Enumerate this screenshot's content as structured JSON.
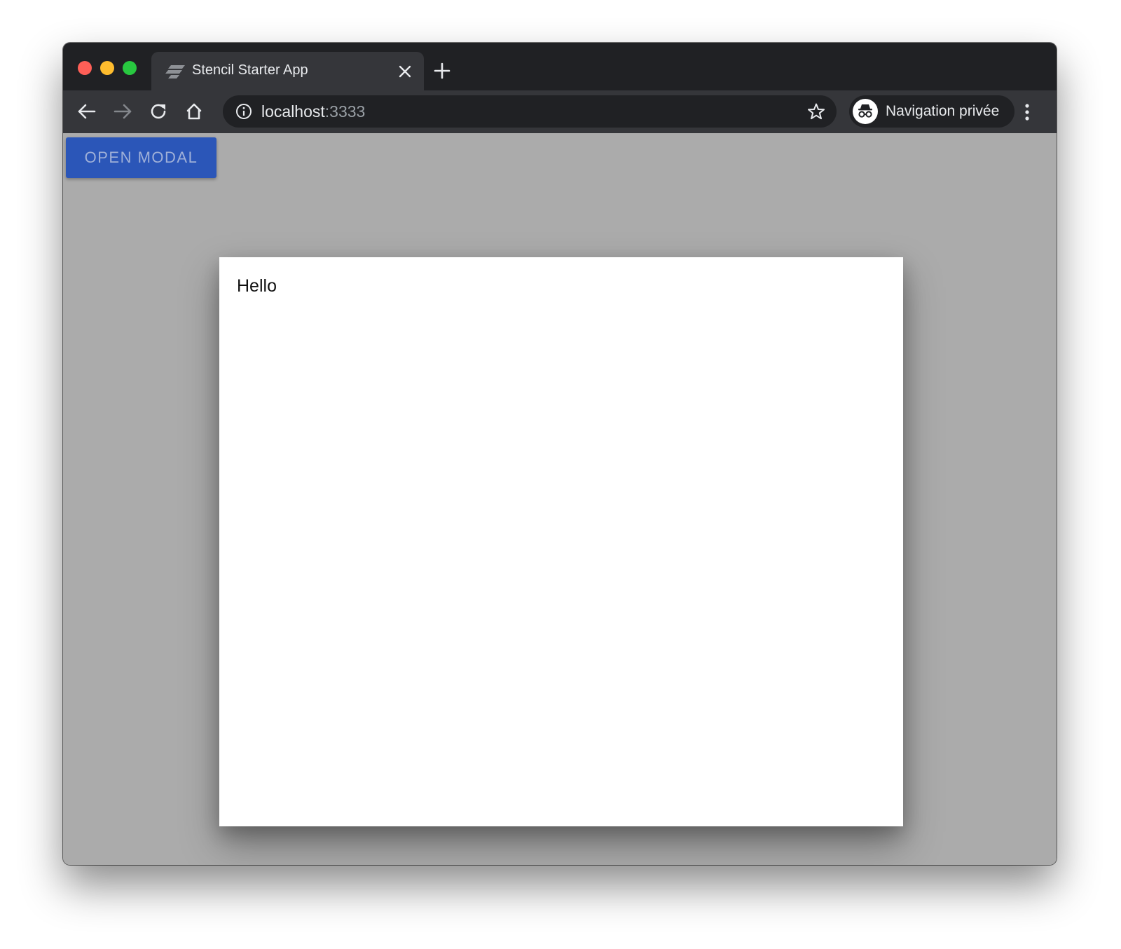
{
  "browser": {
    "tab": {
      "title": "Stencil Starter App",
      "favicon": "stencil-logo-icon",
      "close_icon": "close-icon"
    },
    "new_tab_icon": "plus-icon",
    "nav": {
      "back_icon": "arrow-left-icon",
      "forward_icon": "arrow-right-icon",
      "reload_icon": "reload-icon",
      "home_icon": "home-icon"
    },
    "omnibox": {
      "host": "localhost",
      "port": ":3333",
      "info_icon": "info-icon",
      "bookmark_icon": "star-icon"
    },
    "profile": {
      "label": "Navigation privée",
      "icon": "incognito-icon"
    },
    "menu_icon": "kebab-menu-icon"
  },
  "page": {
    "open_modal_label": "OPEN MODAL",
    "modal": {
      "text": "Hello"
    }
  },
  "colors": {
    "tabstrip": "#202124",
    "toolbar": "#35363a",
    "backdrop": "#ababab",
    "button": "#2b56b8",
    "modal": "#ffffff"
  }
}
